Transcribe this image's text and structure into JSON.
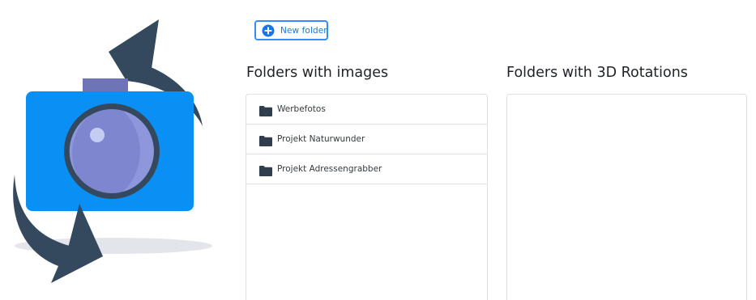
{
  "toolbar": {
    "new_folder_label": "New folder"
  },
  "images_section": {
    "title": "Folders with images",
    "folders": [
      {
        "label": "Werbefotos"
      },
      {
        "label": "Projekt Naturwunder"
      },
      {
        "label": "Projekt Adressengrabber"
      }
    ]
  },
  "rotations_section": {
    "title": "Folders with 3D Rotations",
    "folders": []
  },
  "colors": {
    "accent": "#2f8ff7",
    "camera_body": "#0a90f5",
    "camera_top": "#6f73b8",
    "arrow": "#34495e",
    "lens_inner": "#7e86cf"
  },
  "icons": {
    "logo": "rotating-camera-logo",
    "button": "plus-circle-icon",
    "folder": "folder-icon"
  }
}
